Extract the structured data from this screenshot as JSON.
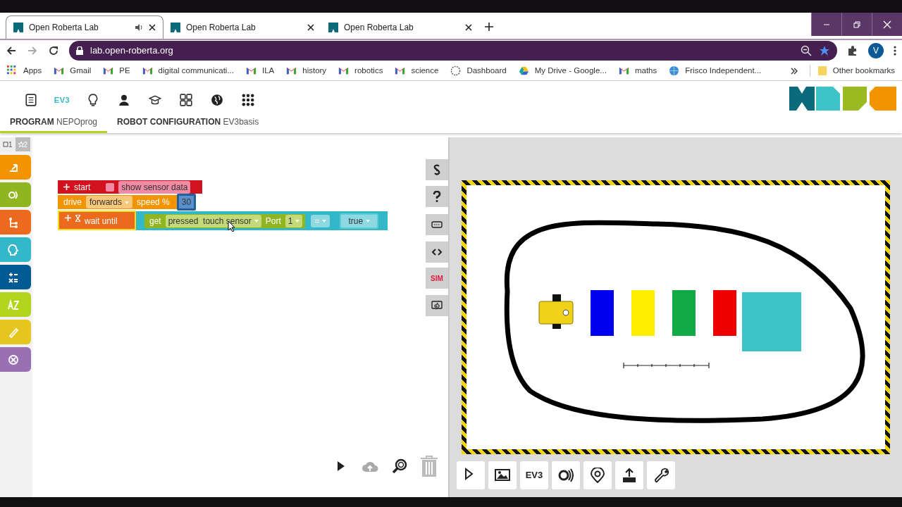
{
  "browser": {
    "tabs": [
      {
        "title": "Open Roberta Lab",
        "selected": true,
        "audio": true
      },
      {
        "title": "Open Roberta Lab",
        "selected": false,
        "audio": false
      },
      {
        "title": "Open Roberta Lab",
        "selected": false,
        "audio": false
      }
    ],
    "url": "lab.open-roberta.org",
    "avatar": "V",
    "bookmarks": [
      {
        "label": "Apps",
        "kind": "apps"
      },
      {
        "label": "Gmail",
        "kind": "gmail"
      },
      {
        "label": "PE",
        "kind": "gmail"
      },
      {
        "label": "digital communicati...",
        "kind": "gmail"
      },
      {
        "label": "ILA",
        "kind": "gmail"
      },
      {
        "label": "history",
        "kind": "gmail"
      },
      {
        "label": "robotics",
        "kind": "gmail"
      },
      {
        "label": "science",
        "kind": "gmail"
      },
      {
        "label": "Dashboard",
        "kind": "dashboard"
      },
      {
        "label": "My Drive - Google...",
        "kind": "drive"
      },
      {
        "label": "maths",
        "kind": "gmail"
      },
      {
        "label": "Frisco Independent...",
        "kind": "globe"
      }
    ],
    "other_bookmarks": "Other bookmarks"
  },
  "app_toolbar": {
    "robot_label": "EV3"
  },
  "program_tabs": [
    {
      "label": "PROGRAM",
      "value": "NEPOprog",
      "selected": true
    },
    {
      "label": "ROBOT CONFIGURATION",
      "value": "EV3basis",
      "selected": false
    }
  ],
  "workspace": {
    "badges": [
      {
        "text": "1",
        "selected": false
      },
      {
        "text": "2",
        "selected": true
      }
    ],
    "categories": [
      {
        "color": "#f29400"
      },
      {
        "color": "#8fb520"
      },
      {
        "color": "#eb6a1e"
      },
      {
        "color": "#33b8ca"
      },
      {
        "color": "#005a94"
      },
      {
        "color": "#b3d41c"
      },
      {
        "color": "#e5c51e"
      },
      {
        "color": "#9a70b4"
      }
    ],
    "blocks": [
      {
        "kind": "start",
        "label": "start",
        "checked": false,
        "field": "show sensor data"
      },
      {
        "kind": "drive",
        "label": "drive",
        "direction": "forwards",
        "speed_label": "speed %",
        "value": "30"
      },
      {
        "kind": "wait",
        "label": "wait until",
        "selected": true,
        "get": "get",
        "sensor": "pressed  touch sensor",
        "port_label": "Port",
        "port": "1",
        "operator": "=",
        "compare": "true"
      }
    ]
  },
  "side_tabs": {
    "sim_label": "SIM"
  },
  "simulation": {
    "obstacles": [
      {
        "color": "#0000ee"
      },
      {
        "color": "#ffee00"
      },
      {
        "color": "#11aa44"
      },
      {
        "color": "#ee0000"
      },
      {
        "color": "#3cc3c8"
      }
    ]
  },
  "sim_toolbar": {
    "robot_label": "EV3"
  }
}
